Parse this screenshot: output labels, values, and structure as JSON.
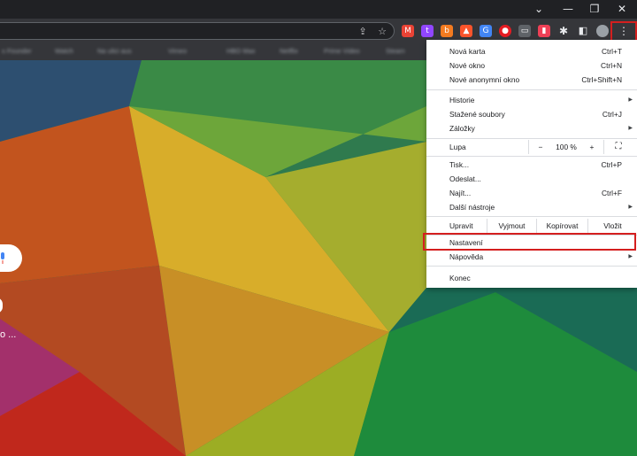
{
  "window_controls": {
    "tabs_dropdown": "⌄",
    "minimize": "—",
    "restore": "❐",
    "close": "✕"
  },
  "omnibox": {
    "share_icon": "share-icon",
    "star_icon": "star-icon"
  },
  "extensions": [
    {
      "name": "gmail",
      "glyph": "M",
      "color": "#ea4335"
    },
    {
      "name": "twitch",
      "glyph": "t",
      "color": "#9146ff"
    },
    {
      "name": "b",
      "glyph": "b",
      "color": "#f47b20"
    },
    {
      "name": "brave",
      "glyph": "▲",
      "color": "#fb542b"
    },
    {
      "name": "translate",
      "glyph": "G",
      "color": "#4285f4"
    },
    {
      "name": "ext-blue",
      "glyph": "■",
      "color": "#1a73e8"
    },
    {
      "name": "adblock",
      "glyph": "●",
      "color": "#e51c23"
    },
    {
      "name": "ext-grey",
      "glyph": "▭",
      "color": "#5f6368"
    },
    {
      "name": "pocket",
      "glyph": "▮",
      "color": "#ef4056"
    },
    {
      "name": "ext-doc",
      "glyph": "▤",
      "color": "#5f6368"
    }
  ],
  "bookmarks": [
    "s Founder",
    "Watch",
    "Na ulici aus",
    "Vimeo",
    "HBO Max",
    "Netflix",
    "Prime Video",
    "Steam"
  ],
  "menu": {
    "new_tab": {
      "label": "Nová karta",
      "shortcut": "Ctrl+T"
    },
    "new_window": {
      "label": "Nové okno",
      "shortcut": "Ctrl+N"
    },
    "incognito": {
      "label": "Nové anonymní okno",
      "shortcut": "Ctrl+Shift+N"
    },
    "history": {
      "label": "Historie"
    },
    "downloads": {
      "label": "Stažené soubory",
      "shortcut": "Ctrl+J"
    },
    "bookmarks": {
      "label": "Záložky"
    },
    "zoom": {
      "label": "Lupa",
      "minus": "−",
      "value": "100 %",
      "plus": "+"
    },
    "print": {
      "label": "Tisk...",
      "shortcut": "Ctrl+P"
    },
    "cast": {
      "label": "Odeslat..."
    },
    "find": {
      "label": "Najít...",
      "shortcut": "Ctrl+F"
    },
    "more_tools": {
      "label": "Další nástroje"
    },
    "edit": {
      "label": "Upravit",
      "cut": "Vyjmout",
      "copy": "Kopírovat",
      "paste": "Vložit"
    },
    "settings": {
      "label": "Nastavení"
    },
    "help": {
      "label": "Nápověda"
    },
    "exit": {
      "label": "Konec"
    }
  },
  "page": {
    "shortcut_label": "o ..."
  },
  "colors": {
    "highlight": "#d41f1f",
    "menu_bg": "#ffffff",
    "toolbar": "#35363a",
    "titlebar": "#202124"
  }
}
